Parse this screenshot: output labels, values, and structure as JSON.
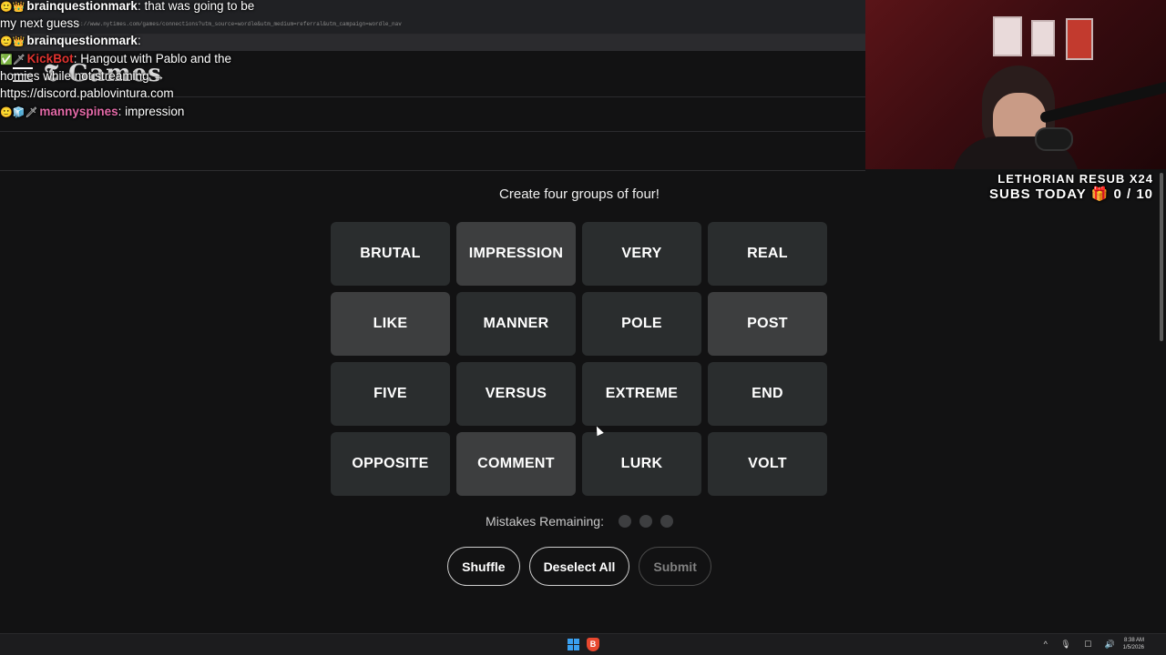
{
  "browser": {
    "url": "https://www.nytimes.com/games/connections?utm_source=wordle&utm_medium=referral&utm_campaign=wordle_nav"
  },
  "header": {
    "logo_text": "Games",
    "menu_icon": "hamburger-icon"
  },
  "chat": [
    {
      "badges": "🙂👑",
      "user": "brainquestionmark",
      "user_color": "#ffffff",
      "message": ": that was going to be"
    },
    {
      "badges": "",
      "user": "",
      "user_color": "#ffffff",
      "message": "my next guess"
    },
    {
      "badges": "🙂👑",
      "user": "brainquestionmark",
      "user_color": "#ffffff",
      "message": ":"
    },
    {
      "badges": "✅🗡",
      "user": "KickBot",
      "user_color": "#e0332f",
      "message": ": Hangout with Pablo and the"
    },
    {
      "badges": "",
      "user": "",
      "user_color": "#ffffff",
      "message": "homies while not streaming →"
    },
    {
      "badges": "",
      "user": "",
      "user_color": "#ffffff",
      "message": "https://discord.pablovintura.com"
    },
    {
      "badges": "🙂🧊🗡",
      "user": "mannyspines",
      "user_color": "#e46aa8",
      "message": ": impression"
    }
  ],
  "overlay": {
    "resub_text": "LETHORIAN RESUB X24",
    "subs_label": "SUBS TODAY",
    "gift_icon": "🎁",
    "subs_count": "0 / 10"
  },
  "game": {
    "prompt": "Create four groups of four!",
    "tiles": [
      {
        "word": "BRUTAL",
        "selected": false
      },
      {
        "word": "IMPRESSION",
        "selected": true
      },
      {
        "word": "VERY",
        "selected": false
      },
      {
        "word": "REAL",
        "selected": false
      },
      {
        "word": "LIKE",
        "selected": true
      },
      {
        "word": "MANNER",
        "selected": false
      },
      {
        "word": "POLE",
        "selected": false
      },
      {
        "word": "POST",
        "selected": true
      },
      {
        "word": "FIVE",
        "selected": false
      },
      {
        "word": "VERSUS",
        "selected": false
      },
      {
        "word": "EXTREME",
        "selected": false
      },
      {
        "word": "END",
        "selected": false
      },
      {
        "word": "OPPOSITE",
        "selected": false
      },
      {
        "word": "COMMENT",
        "selected": true
      },
      {
        "word": "LURK",
        "selected": false
      },
      {
        "word": "VOLT",
        "selected": false
      }
    ],
    "mistakes_label": "Mistakes Remaining:",
    "mistakes_remaining": 3,
    "buttons": {
      "shuffle": "Shuffle",
      "deselect": "Deselect All",
      "submit": "Submit"
    }
  },
  "taskbar": {
    "time": "8:38 AM",
    "date": "1/5/2026",
    "tray_icons": "^ 🎙 ☐ 🔊"
  }
}
